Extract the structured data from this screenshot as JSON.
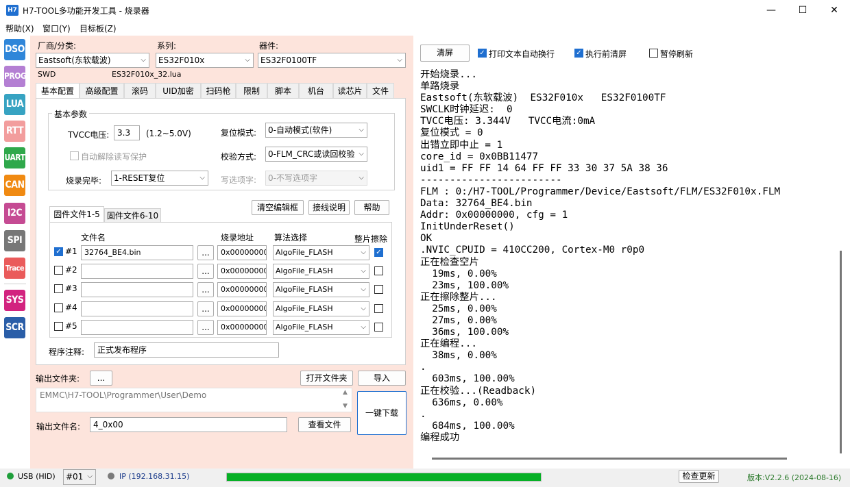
{
  "window": {
    "icon_text": "H7",
    "title": "H7-TOOL多功能开发工具 - 烧录器",
    "minimize": "—",
    "maximize": "☐",
    "close": "✕"
  },
  "menu": [
    "帮助(X)",
    "窗口(Y)",
    "目标板(Z)"
  ],
  "sidebar": [
    {
      "label": "DSO",
      "color": "#2f86d9"
    },
    {
      "label": "PROG",
      "color": "#b47fd3"
    },
    {
      "label": "LUA",
      "color": "#37a3c2"
    },
    {
      "label": "RTT",
      "color": "#f29d9d"
    },
    {
      "label": "UART",
      "color": "#2fa84b"
    },
    {
      "label": "CAN",
      "color": "#f08a12"
    },
    {
      "label": "I2C",
      "color": "#c54b93"
    },
    {
      "label": "SPI",
      "color": "#777777"
    },
    {
      "label": "Trace",
      "color": "#ea5b5b"
    },
    {
      "label": "SYS",
      "color": "#d2237f"
    },
    {
      "label": "SCR",
      "color": "#2a5ea8"
    }
  ],
  "device": {
    "vendor_label": "厂商/分类:",
    "vendor": "Eastsoft(东软载波)",
    "series_label": "系列:",
    "series": "ES32F010x",
    "part_label": "器件:",
    "part": "ES32F0100TF",
    "interface": "SWD",
    "lua_file": "ES32F010x_32.lua"
  },
  "tabs": [
    "基本配置",
    "高级配置",
    "滚码",
    "UID加密",
    "扫码枪",
    "限制",
    "脚本",
    "机台",
    "读芯片",
    "文件"
  ],
  "basic": {
    "group_title": "基本参数",
    "tvcc_label": "TVCC电压:",
    "tvcc_value": "3.3",
    "tvcc_range": "(1.2~5.0V)",
    "auto_unlock": "自动解除读写保护",
    "finish_label": "烧录完毕:",
    "finish_value": "1-RESET复位",
    "reset_label": "复位模式:",
    "reset_value": "0-自动模式(软件)",
    "verify_label": "校验方式:",
    "verify_value": "0-FLM_CRC或读回校验",
    "option_label": "写选项字:",
    "option_value": "0-不写选项字"
  },
  "files": {
    "tab1": "固件文件1-5",
    "tab2": "固件文件6-10",
    "clear_btn": "清空编辑框",
    "wiring_btn": "接线说明",
    "help_btn": "帮助",
    "col_file": "文件名",
    "col_addr": "烧录地址",
    "col_algo": "算法选择",
    "col_erase": "整片擦除",
    "browse": "...",
    "rows": [
      {
        "id": "#1",
        "checked": true,
        "file": "32764_BE4.bin",
        "addr": "0x00000000",
        "algo": "AlgoFile_FLASH",
        "erase": true
      },
      {
        "id": "#2",
        "checked": false,
        "file": "",
        "addr": "0x00000000",
        "algo": "AlgoFile_FLASH",
        "erase": false
      },
      {
        "id": "#3",
        "checked": false,
        "file": "",
        "addr": "0x00000000",
        "algo": "AlgoFile_FLASH",
        "erase": false
      },
      {
        "id": "#4",
        "checked": false,
        "file": "",
        "addr": "0x00000000",
        "algo": "AlgoFile_FLASH",
        "erase": false
      },
      {
        "id": "#5",
        "checked": false,
        "file": "",
        "addr": "0x00000000",
        "algo": "AlgoFile_FLASH",
        "erase": false
      }
    ],
    "note_label": "程序注释:",
    "note_value": "正式发布程序"
  },
  "output": {
    "folder_label": "输出文件夹:",
    "folder_btn": "...",
    "open_folder_btn": "打开文件夹",
    "import_btn": "导入",
    "path": "EMMC\\H7-TOOL\\Programmer\\User\\Demo",
    "name_label": "输出文件名:",
    "name_value": "4_0x00",
    "view_btn": "查看文件",
    "download_btn": "一键下载"
  },
  "console_toolbar": {
    "clear_btn": "清屏",
    "wrap": "打印文本自动换行",
    "clear_before": "执行前清屏",
    "pause": "暂停刷新"
  },
  "console_lines": [
    "开始烧录...",
    "单路烧录",
    "Eastsoft(东软载波)  ES32F010x   ES32F0100TF",
    "SWCLK时钟延迟:  0",
    "TVCC电压: 3.344V   TVCC电流:0mA",
    "复位模式 = 0",
    "出错立即中止 = 1",
    "core_id = 0x0BB11477",
    "uid1 = FF FF 14 64 FF FF 33 30 37 5A 38 36",
    "------------------------",
    "FLM : 0:/H7-TOOL/Programmer/Device/Eastsoft/FLM/ES32F010x.FLM",
    "Data: 32764_BE4.bin",
    "Addr: 0x00000000, cfg = 1",
    "InitUnderReset()",
    "OK",
    ".NVIC_CPUID = 410CC200, Cortex-M0 r0p0",
    "正在检查空片",
    "  19ms, 0.00%",
    "  23ms, 100.00%",
    "正在擦除整片...",
    "  25ms, 0.00%",
    "  27ms, 0.00%",
    "  36ms, 100.00%",
    "正在编程...",
    "  38ms, 0.00%",
    ".",
    "  603ms, 100.00%",
    "正在校验...(Readback)",
    "  636ms, 0.00%",
    ".",
    "  684ms, 100.00%",
    "编程成功"
  ],
  "status": {
    "usb": "USB (HID)",
    "usb_dot_color": "#1e9e3a",
    "device_no": "#01",
    "ip": "IP (192.168.31.15)",
    "ip_dot_color": "#7a7a7a",
    "progress": 1.0,
    "check_update": "检查更新",
    "version": "版本:V2.2.6 (2024-08-16)"
  }
}
